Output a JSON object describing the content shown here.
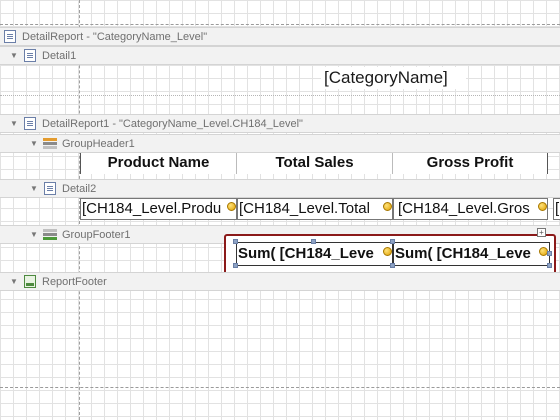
{
  "bands": {
    "detail_report": "DetailReport - \"CategoryName_Level\"",
    "detail1": "Detail1",
    "detail_report1": "DetailReport1 - \"CategoryName_Level.CH184_Level\"",
    "group_header1": "GroupHeader1",
    "detail2": "Detail2",
    "group_footer1": "GroupFooter1",
    "report_footer": "ReportFooter"
  },
  "detail1": {
    "category_name": "[CategoryName]"
  },
  "group_header1": {
    "headers": [
      "Product Name",
      "Total Sales",
      "Gross Profit"
    ]
  },
  "detail2": {
    "cells": [
      "[CH184_Level.Produ",
      "[CH184_Level.Total",
      "[CH184_Level.Gros",
      "["
    ]
  },
  "group_footer1": {
    "sums": [
      "Sum( [CH184_Leve",
      "Sum( [CH184_Leve"
    ]
  },
  "colors": {
    "selection": "#8b1a1a",
    "band": "#f2f2f2",
    "tag": "#f0b400"
  },
  "icons": [
    "report-icon",
    "detail-band-icon",
    "group-header-icon",
    "group-footer-icon",
    "report-footer-icon",
    "collapse-arrow-icon",
    "smart-tag-icon"
  ]
}
